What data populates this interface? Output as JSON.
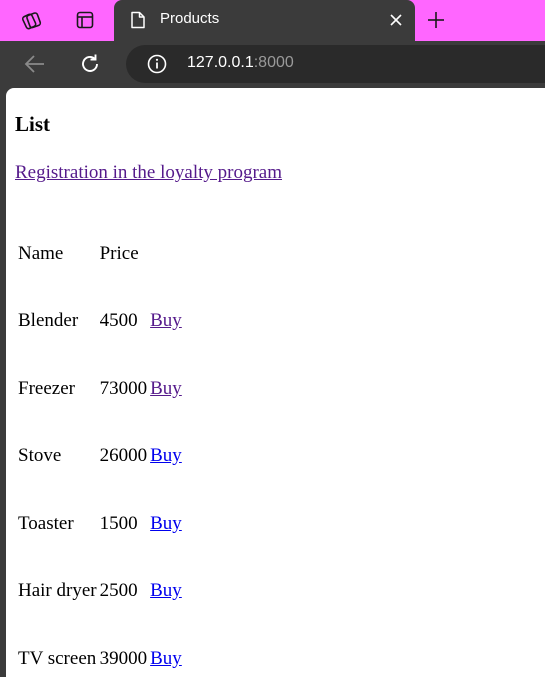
{
  "browser": {
    "tab_title": "Products",
    "url_host": "127.0.0.1",
    "url_port": ":8000",
    "colors": {
      "tabstrip": "#ff66ff",
      "chrome": "#3b3b3b",
      "address_bar": "#2a2a2a"
    }
  },
  "page": {
    "heading": "List",
    "loyalty_link": "Registration in the loyalty program",
    "table": {
      "headers": [
        "Name",
        "Price"
      ],
      "rows": [
        {
          "name": "Blender",
          "price": "4500",
          "action": "Buy"
        },
        {
          "name": "Freezer",
          "price": "73000",
          "action": "Buy"
        },
        {
          "name": "Stove",
          "price": "26000",
          "action": "Buy"
        },
        {
          "name": "Toaster",
          "price": "1500",
          "action": "Buy"
        },
        {
          "name": "Hair dryer",
          "price": "2500",
          "action": "Buy"
        },
        {
          "name": "TV screen",
          "price": "39000",
          "action": "Buy"
        }
      ]
    },
    "link_colors": {
      "visited": "#551a8b",
      "unvisited": "#0000ee"
    }
  }
}
